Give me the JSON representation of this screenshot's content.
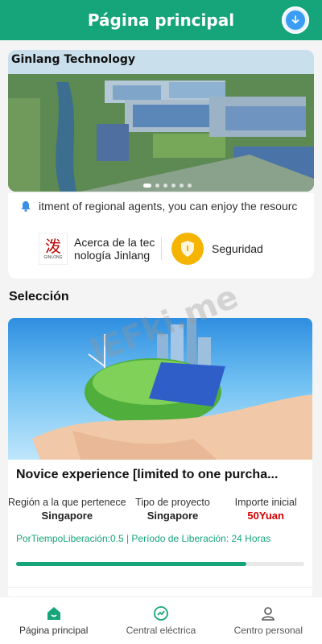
{
  "header": {
    "title": "Página principal"
  },
  "banner": {
    "title": "Ginlang Technology"
  },
  "notice": {
    "text": "itment of regional agents, you can enjoy the resourc"
  },
  "info": {
    "about_label": "Acerca de la tecnología Jinlang",
    "logo_text": "GINLONG",
    "security_label": "Seguridad"
  },
  "section": {
    "title": "Selección"
  },
  "product": {
    "name": "Novice experience [limited to one purcha...",
    "cols": [
      {
        "label": "Región a la que pertenece",
        "value": "Singapore"
      },
      {
        "label": "Tipo de proyecto",
        "value": "Singapore"
      },
      {
        "label": "Importe inicial",
        "value": "50Yuan"
      }
    ],
    "release": "PorTiempoLiberación:0.5  | Período de Liberación:  24 Horas",
    "progress": 0.8
  },
  "watermark": "lEFki.me",
  "tabs": [
    {
      "label": "Página principal"
    },
    {
      "label": "Central eléctrica"
    },
    {
      "label": "Centro personal"
    }
  ],
  "colors": {
    "primary": "#16a57a",
    "accent_red": "#d40000",
    "shield": "#f4b400"
  }
}
